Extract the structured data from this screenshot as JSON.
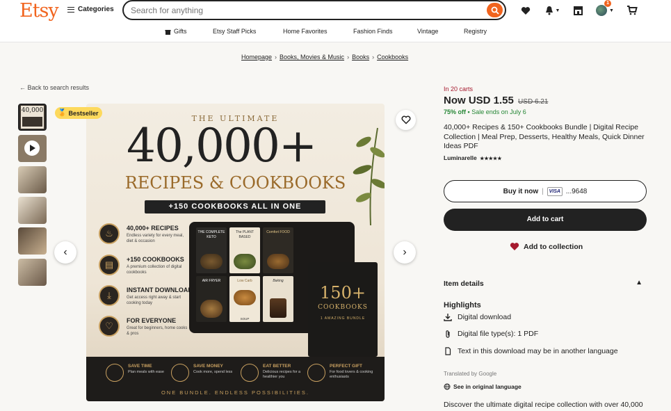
{
  "header": {
    "logo": "Etsy",
    "categories_label": "Categories",
    "search_placeholder": "Search for anything",
    "notification_count": "1"
  },
  "nav": {
    "items": [
      "Gifts",
      "Etsy Staff Picks",
      "Home Favorites",
      "Fashion Finds",
      "Vintage",
      "Registry"
    ]
  },
  "breadcrumb": [
    "Homepage",
    "Books, Movies & Music",
    "Books",
    "Cookbooks"
  ],
  "back_link": "Back to search results",
  "badge": "Bestseller",
  "product_image": {
    "top_label": "THE ULTIMATE",
    "big_number": "40,000+",
    "subtitle": "RECIPES & COOKBOOKS",
    "band": "+150 COOKBOOKS ALL IN ONE",
    "features": [
      {
        "title": "40,000+ RECIPES",
        "desc": "Endless variety for every meal, diet & occasion",
        "icon": "chef-hat-icon"
      },
      {
        "title": "+150 COOKBOOKS",
        "desc": "A premium collection of digital cookbooks",
        "icon": "book-icon"
      },
      {
        "title": "INSTANT DOWNLOAD",
        "desc": "Get access right away & start cooking today",
        "icon": "download-icon"
      },
      {
        "title": "FOR EVERYONE",
        "desc": "Great for beginners, home cooks & pros",
        "icon": "heart-icon"
      }
    ],
    "books": [
      "THE COMPLETE KETO",
      "The PLANT BASED",
      "Comfort FOOD",
      "AIR FRYER",
      "Low Carb",
      "Baking",
      "SOUP"
    ],
    "black_book": {
      "number": "150+",
      "label": "COOKBOOKS",
      "sub": "1 AMAZING BUNDLE"
    },
    "bottom_items": [
      {
        "title": "SAVE TIME",
        "desc": "Plan meals with ease"
      },
      {
        "title": "SAVE MONEY",
        "desc": "Cook more, spend less"
      },
      {
        "title": "EAT BETTER",
        "desc": "Delicious recipes for a healthier you"
      },
      {
        "title": "PERFECT GIFT",
        "desc": "For food lovers & cooking enthusiasts"
      }
    ],
    "tagline": "ONE BUNDLE. ENDLESS POSSIBILITIES."
  },
  "product": {
    "in_carts": "In 20 carts",
    "price_now": "Now USD 1.55",
    "price_orig": "USD 6.21",
    "discount": "75% off",
    "sale_ends": "Sale ends on July 6",
    "title": "40,000+ Recipes & 150+ Cookbooks Bundle | Digital Recipe Collection | Meal Prep, Desserts, Healthy Meals, Quick Dinner Ideas PDF",
    "shop": "Luminarelle",
    "stars": "★★★★★",
    "buy_now": "Buy it now",
    "card_brand": "VISA",
    "card_last4": "...9648",
    "add_to_cart": "Add to cart",
    "add_to_collection": "Add to collection",
    "item_details": "Item details",
    "highlights_title": "Highlights",
    "highlights": [
      {
        "text": "Digital download",
        "icon": "download-icon"
      },
      {
        "text": "Digital file type(s): 1 PDF",
        "icon": "paperclip-icon"
      },
      {
        "text": "Text in this download may be in another language",
        "icon": "document-icon"
      }
    ],
    "translated_by": "Translated by Google",
    "see_original": "See in original language",
    "description_start": "Discover the ultimate digital recipe collection with over 40,000"
  },
  "colors": {
    "brand": "#f1641e",
    "dark": "#222222",
    "sale_red": "#a61a2e",
    "sale_green": "#258635"
  }
}
